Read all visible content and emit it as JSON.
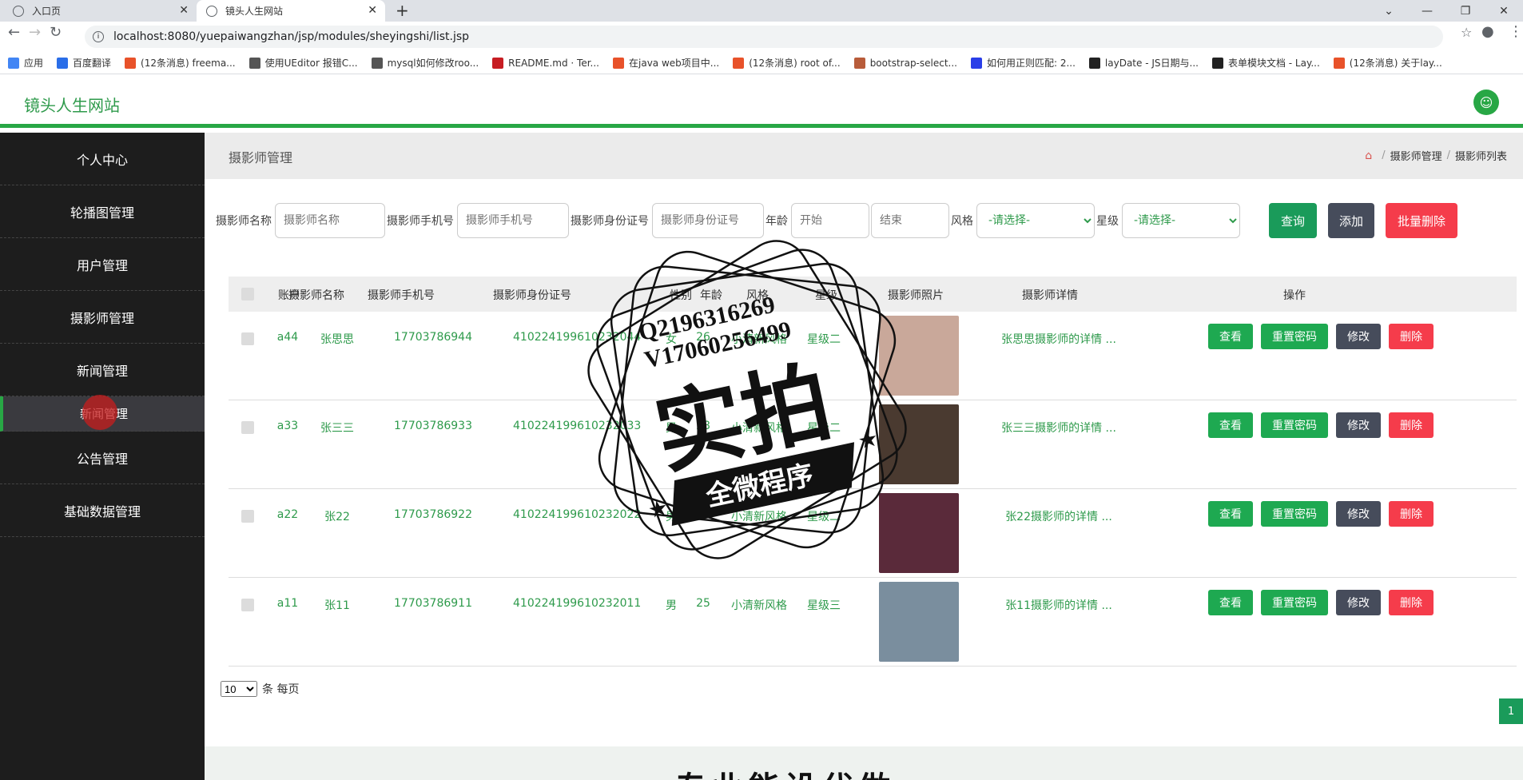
{
  "browser": {
    "tabs": [
      {
        "title": "入口页"
      },
      {
        "title": "镜头人生网站"
      }
    ],
    "url": "localhost:8080/yuepaiwangzhan/jsp/modules/sheyingshi/list.jsp",
    "bookmarks": [
      {
        "label": "应用",
        "color": "#4285f4"
      },
      {
        "label": "百度翻译",
        "color": "#2a6ee8"
      },
      {
        "label": "(12条消息) freema...",
        "color": "#e8522a"
      },
      {
        "label": "使用UEditor 报错C...",
        "color": "#555555"
      },
      {
        "label": "mysql如何修改roo...",
        "color": "#555555"
      },
      {
        "label": "README.md · Ter...",
        "color": "#c71d23"
      },
      {
        "label": "在java web项目中...",
        "color": "#e8522a"
      },
      {
        "label": "(12条消息) root of...",
        "color": "#e8522a"
      },
      {
        "label": "bootstrap-select...",
        "color": "#b85c3a"
      },
      {
        "label": "如何用正则匹配: 2...",
        "color": "#2a3ee8"
      },
      {
        "label": "layDate - JS日期与...",
        "color": "#222222"
      },
      {
        "label": "表单模块文档 - Lay...",
        "color": "#222222"
      },
      {
        "label": "(12条消息) 关于lay...",
        "color": "#e8522a"
      }
    ]
  },
  "app": {
    "brand": "镜头人生网站",
    "accent": "#28a745"
  },
  "sidebar": {
    "items": [
      {
        "label": "个人中心"
      },
      {
        "label": "轮播图管理"
      },
      {
        "label": "用户管理"
      },
      {
        "label": "摄影师管理"
      },
      {
        "label": "新闻管理"
      },
      {
        "label": "新闻管理",
        "sub": true
      },
      {
        "label": "公告管理"
      },
      {
        "label": "基础数据管理"
      }
    ]
  },
  "breadcrumb": {
    "title": "摄影师管理",
    "path1": "摄影师管理",
    "sep": "/",
    "path2": "摄影师列表"
  },
  "filters": {
    "name_label": "摄影师名称",
    "name_placeholder": "摄影师名称",
    "phone_label": "摄影师手机号",
    "phone_placeholder": "摄影师手机号",
    "id_label": "摄影师身份证号",
    "id_placeholder": "摄影师身份证号",
    "age_label": "年龄",
    "age_start_placeholder": "开始",
    "age_end_placeholder": "结束",
    "style_label": "风格",
    "style_value": "-请选择-",
    "star_label": "星级",
    "star_value": "-请选择-",
    "query_label": "查询",
    "add_label": "添加",
    "batch_delete_label": "批量删除"
  },
  "table": {
    "headers": [
      "账户",
      "摄影师名称",
      "摄影师手机号",
      "摄影师身份证号",
      "性别",
      "年龄",
      "风格",
      "星级",
      "摄影师照片",
      "摄影师详情",
      "操作"
    ],
    "action_labels": {
      "view": "查看",
      "reset": "重置密码",
      "edit": "修改",
      "delete": "删除"
    },
    "rows": [
      {
        "account": "a44",
        "name": "张思思",
        "phone": "17703786944",
        "id": "410224199610232044",
        "gender": "女",
        "age": "26",
        "style": "小清新风格",
        "star": "星级二",
        "detail": "张思思摄影师的详情 ...",
        "photo_bg": "#c9a89a"
      },
      {
        "account": "a33",
        "name": "张三三",
        "phone": "17703786933",
        "id": "410224199610232033",
        "gender": "男",
        "age": "28",
        "style": "小清新风格",
        "star": "星级二",
        "detail": "张三三摄影师的详情 ...",
        "photo_bg": "#4a3a30"
      },
      {
        "account": "a22",
        "name": "张22",
        "phone": "17703786922",
        "id": "410224199610232022",
        "gender": "男",
        "age": "24",
        "style": "小清新风格",
        "star": "星级二",
        "detail": "张22摄影师的详情 ...",
        "photo_bg": "#5a2a3a"
      },
      {
        "account": "a11",
        "name": "张11",
        "phone": "17703786911",
        "id": "410224199610232011",
        "gender": "男",
        "age": "25",
        "style": "小清新风格",
        "star": "星级三",
        "detail": "张11摄影师的详情 ...",
        "photo_bg": "#7a8e9e"
      }
    ]
  },
  "pager": {
    "page_size": "10",
    "suffix": "条 每页",
    "current_page": "1"
  },
  "footer": {
    "text": "专业能设代做"
  },
  "watermark": {
    "line1": "Q2196316269",
    "line2": "V17060256499",
    "big": "实拍",
    "banner": "全微程序"
  }
}
